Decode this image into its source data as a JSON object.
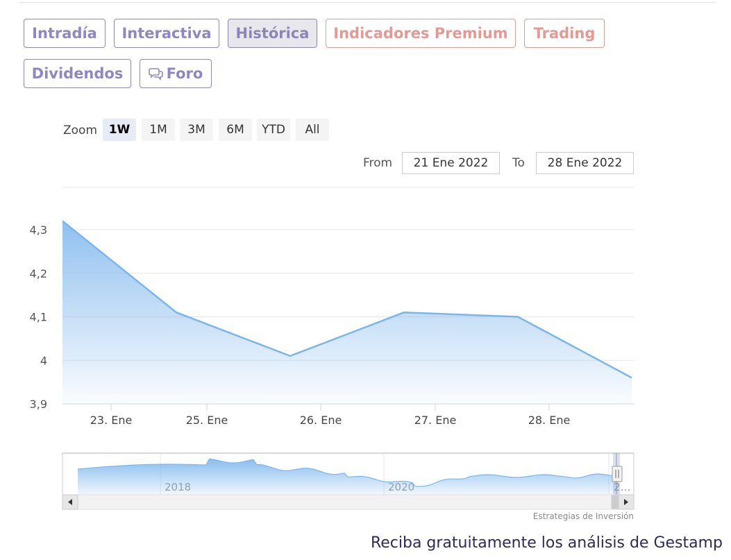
{
  "tabs": [
    {
      "label": "Intradía",
      "style": "default"
    },
    {
      "label": "Interactiva",
      "style": "default"
    },
    {
      "label": "Histórica",
      "style": "active"
    },
    {
      "label": "Indicadores Premium",
      "style": "premium"
    },
    {
      "label": "Trading",
      "style": "premium"
    },
    {
      "label": "Dividendos",
      "style": "default"
    },
    {
      "label": "Foro",
      "style": "default",
      "icon": "chat-bubbles-icon"
    }
  ],
  "zoom": {
    "label": "Zoom",
    "options": [
      "1W",
      "1M",
      "3M",
      "6M",
      "YTD",
      "All"
    ],
    "selected": "1W"
  },
  "range": {
    "from_label": "From",
    "from_value": "21 Ene 2022",
    "to_label": "To",
    "to_value": "28 Ene 2022"
  },
  "chart_data": {
    "type": "area",
    "x": [
      "22. Ene",
      "24. Ene",
      "25. Ene",
      "26. Ene",
      "27. Ene",
      "28. Ene"
    ],
    "values": [
      4.32,
      4.11,
      4.01,
      4.11,
      4.1,
      3.96
    ],
    "x_tick_labels": [
      "23. Ene",
      "25. Ene",
      "26. Ene",
      "27. Ene",
      "28. Ene"
    ],
    "y_tick_labels": [
      "3,9",
      "4",
      "4,1",
      "4,2",
      "4,3"
    ],
    "ylim": [
      3.9,
      4.3
    ],
    "grid": true,
    "line_color": "#7cb5ec",
    "navigator": {
      "labels": [
        "2018",
        "2020",
        "2…"
      ]
    }
  },
  "credits": "Estrategias de Inversión",
  "cta": "Reciba gratuitamente los análisis de Gestamp"
}
